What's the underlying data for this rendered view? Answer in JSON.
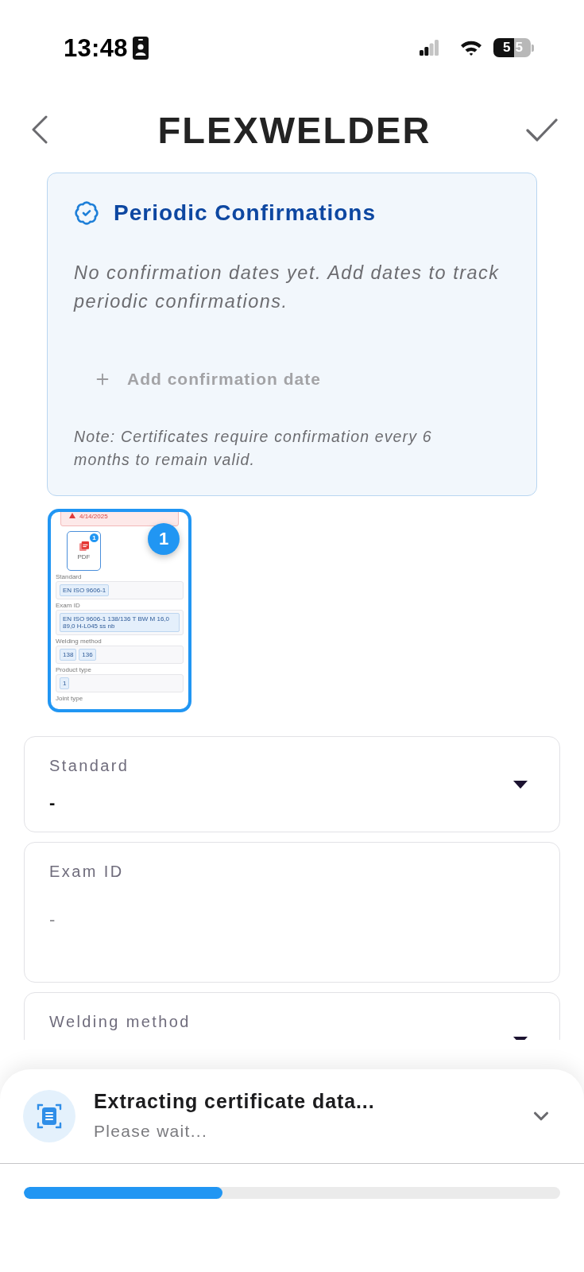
{
  "status_bar": {
    "time": "13:48",
    "battery": "55"
  },
  "header": {
    "logo": "FLEXWELDER"
  },
  "confirmations": {
    "title": "Periodic Confirmations",
    "message": "No confirmation dates yet. Add dates to track periodic confirmations.",
    "add_button": "Add confirmation date",
    "note": "Note: Certificates require confirmation every 6 months to remain valid."
  },
  "attachment": {
    "selected": true,
    "badge": "1",
    "preview": {
      "alert_date": "4/14/2025",
      "file": {
        "label": "PDF",
        "badge": "1"
      },
      "fields": [
        {
          "label": "Standard",
          "chips": [
            "EN ISO 9606-1"
          ]
        },
        {
          "label": "Exam ID",
          "chips": [
            "EN ISO 9606-1 138/136 T BW M 16,0 89,0 H-L045 ss nb"
          ]
        },
        {
          "label": "Welding method",
          "chips": [
            "138",
            "136"
          ]
        },
        {
          "label": "Product type",
          "chips": [
            "1"
          ]
        },
        {
          "label": "Joint type"
        }
      ]
    }
  },
  "fields": [
    {
      "kind": "select",
      "label": "Standard",
      "value": "-"
    },
    {
      "kind": "textarea",
      "label": "Exam ID",
      "value": "-"
    },
    {
      "kind": "select",
      "label": "Welding method"
    }
  ],
  "progress": {
    "title": "Extracting certificate data...",
    "subtitle": "Please wait...",
    "level": 0.37
  }
}
